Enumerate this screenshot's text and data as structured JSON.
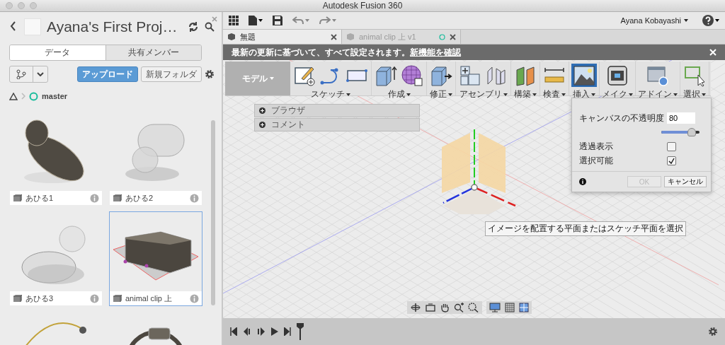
{
  "window": {
    "title": "Autodesk Fusion 360"
  },
  "project": {
    "title": "Ayana's First Proj…"
  },
  "panel_tabs": [
    {
      "label": "データ",
      "selected": true
    },
    {
      "label": "共有メンバー",
      "selected": false
    }
  ],
  "panel_buttons": {
    "upload": "アップロード",
    "new_folder": "新規フォルダ"
  },
  "branch": "master",
  "files": [
    {
      "name": "あひる1",
      "kind": "duck-solid",
      "selected": false
    },
    {
      "name": "あひる2",
      "kind": "duck-ghost",
      "selected": false
    },
    {
      "name": "あひる3",
      "kind": "duck-round",
      "selected": false
    },
    {
      "name": "animal clip 上",
      "kind": "clip",
      "selected": true
    },
    {
      "kind": "wire",
      "selected": false
    },
    {
      "kind": "ring",
      "selected": false
    }
  ],
  "user": "Ayana Kobayashi",
  "doc_tabs": [
    {
      "label": "無題",
      "selected": true
    },
    {
      "label": "animal clip 上 v1",
      "selected": false
    }
  ],
  "notice": {
    "text": "最新の更新に基づいて、すべて設定されます。",
    "link": "新機能を確認"
  },
  "workspace": "モデル",
  "ribbon": [
    {
      "label": "スケッチ",
      "selected": false
    },
    {
      "label": "作成",
      "selected": false
    },
    {
      "label": "修正",
      "selected": false
    },
    {
      "label": "アセンブリ",
      "selected": false
    },
    {
      "label": "構築",
      "selected": false
    },
    {
      "label": "検査",
      "selected": false
    },
    {
      "label": "挿入",
      "selected": true
    },
    {
      "label": "メイク",
      "selected": false
    },
    {
      "label": "アドイン",
      "selected": false
    },
    {
      "label": "選択",
      "selected": false
    }
  ],
  "browser_panels": [
    {
      "label": "ブラウザ"
    },
    {
      "label": "コメント"
    }
  ],
  "tooltip": "イメージを配置する平面またはスケッチ平面を選択",
  "dialog": {
    "opacity_label": "キャンバスの不透明度",
    "opacity_value": "80",
    "level": 0.8,
    "options": [
      {
        "label": "透過表示",
        "checked": false
      },
      {
        "label": "選択可能",
        "checked": true
      }
    ],
    "ok": {
      "label": "OK",
      "disabled": true
    },
    "cancel": "キャンセル"
  }
}
